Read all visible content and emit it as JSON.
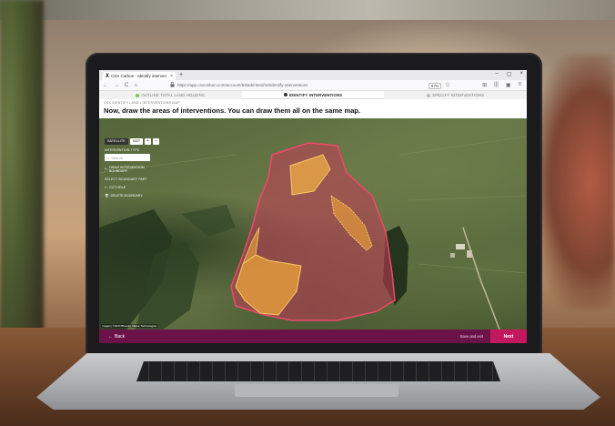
{
  "browser": {
    "tab_logo": "X",
    "tab_title": "CSX Carbon - Identify interven",
    "tab_close": "×",
    "new_tab": "+",
    "window_controls": [
      "–",
      "▢",
      "×"
    ],
    "nav_icons": [
      "←",
      "→",
      "C",
      "⌂"
    ],
    "url": "https://app.csxcarbon.com/account/53/add-land/10/identify-interventions",
    "zoom": "67%",
    "right_icons": [
      "⊞",
      "|||",
      "▣",
      "≡"
    ]
  },
  "steps": [
    {
      "label": "OUTLINE TOTAL LAND HOLDING",
      "state": "done"
    },
    {
      "label": "IDENTIFY INTERVENTIONS",
      "state": "active"
    },
    {
      "label": "SPECIFY INTERVENTIONS",
      "state": "todo"
    }
  ],
  "header": {
    "breadcrumb": "CSX IDENTIFY LAND • INTERVENTIONS MAP",
    "title": "Now, draw the areas of interventions. You can draw them all on the same map."
  },
  "map": {
    "controls": {
      "satellite": "SATELLITE",
      "map": "MAP",
      "zoom_in": "+",
      "zoom_out": "−"
    },
    "panel": {
      "heading": "INTERVENTION TYPE",
      "search_placeholder": "Search",
      "draw_link": "DRAW INTERVENTION BOUNDARY",
      "subheading": "SELECT BOUNDARY PART",
      "cut_link": "CUT HOLE",
      "delete_link": "DELETE BOUNDARY"
    },
    "attribution": "Imagery ©2023 Bluesky, Maxar Technologies",
    "colors": {
      "land_holding": "#d2324e",
      "intervention": "#f0a83a"
    }
  },
  "footer": {
    "back_label": "Back",
    "save_exit_label": "Save and exit",
    "next_label": "Next",
    "bar_color": "#6b1248",
    "next_color": "#c4185e"
  }
}
